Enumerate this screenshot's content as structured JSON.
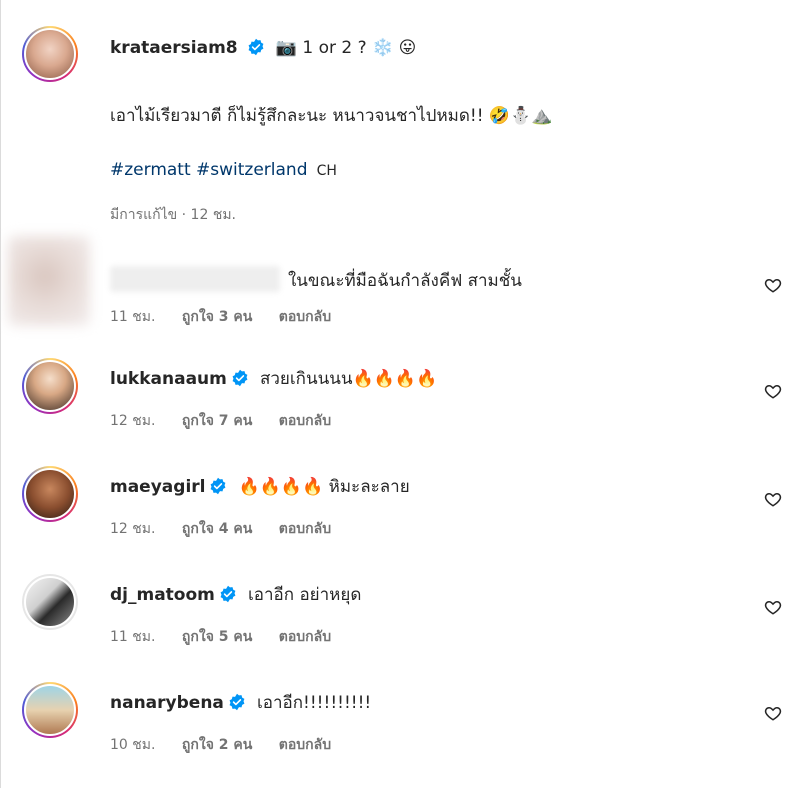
{
  "post": {
    "username": "krataersiam8",
    "caption_head": "📷 1 or 2 ? ❄️ 😛",
    "caption_line2": "เอาไม้เรียวมาตี ก็ไม่รู้สึกละนะ หนาวจนชาไปหมด!! 🤣⛄⛰️",
    "hashtags": "#zermatt #switzerland",
    "country_code": "CH",
    "meta": "มีการแก้ไข · 12 ชม."
  },
  "comments": [
    {
      "username": "",
      "text": "ในขณะที่มือฉันกำลังคีฟ สามชั้น",
      "time": "11 ชม.",
      "likes": "ถูกใจ 3 คน",
      "reply": "ตอบกลับ"
    },
    {
      "username": "lukkanaaum",
      "text": "สวยเกินนนน🔥🔥🔥🔥",
      "time": "12 ชม.",
      "likes": "ถูกใจ 7 คน",
      "reply": "ตอบกลับ"
    },
    {
      "username": "maeyagirl",
      "text": "🔥🔥🔥🔥 หิมะละลาย",
      "time": "12 ชม.",
      "likes": "ถูกใจ 4 คน",
      "reply": "ตอบกลับ"
    },
    {
      "username": "dj_matoom",
      "text": "เอาอีก อย่าหยุด",
      "time": "11 ชม.",
      "likes": "ถูกใจ 5 คน",
      "reply": "ตอบกลับ"
    },
    {
      "username": "nanarybena",
      "text": "เอาอีก!!!!!!!!!!",
      "time": "10 ชม.",
      "likes": "ถูกใจ 2 คน",
      "reply": "ตอบกลับ"
    }
  ],
  "colors": {
    "verified": "#0095f6",
    "hashtag": "#00376b",
    "muted": "#737373"
  }
}
